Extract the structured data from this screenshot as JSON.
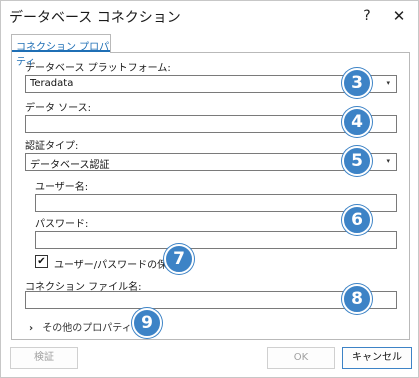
{
  "window": {
    "title": "データベース コネクション",
    "help_label": "?",
    "close_label": "✕"
  },
  "tab": {
    "label": "コネクション プロパティ"
  },
  "platform": {
    "label": "データベース プラットフォーム:",
    "value": "Teradata"
  },
  "data_source": {
    "label": "データ ソース:",
    "value": ""
  },
  "auth_type": {
    "label": "認証タイプ:",
    "value": "データベース認証"
  },
  "username": {
    "label": "ユーザー名:",
    "value": ""
  },
  "password": {
    "label": "パスワード:",
    "value": ""
  },
  "save_credentials": {
    "label": "ユーザー/パスワードの保存",
    "checked": true,
    "mark": "✔"
  },
  "connection_file": {
    "label": "コネクション ファイル名:",
    "value": ""
  },
  "more_properties": {
    "label": "その他のプロパティ",
    "chevron": "›"
  },
  "callouts": [
    "3",
    "4",
    "5",
    "6",
    "7",
    "8",
    "9"
  ],
  "buttons": {
    "validate": "検証",
    "ok": "OK",
    "cancel": "キャンセル"
  },
  "colors": {
    "accent": "#3d83c6",
    "tab_text": "#1f6fb5"
  },
  "icons": {
    "dropdown": "▾"
  }
}
